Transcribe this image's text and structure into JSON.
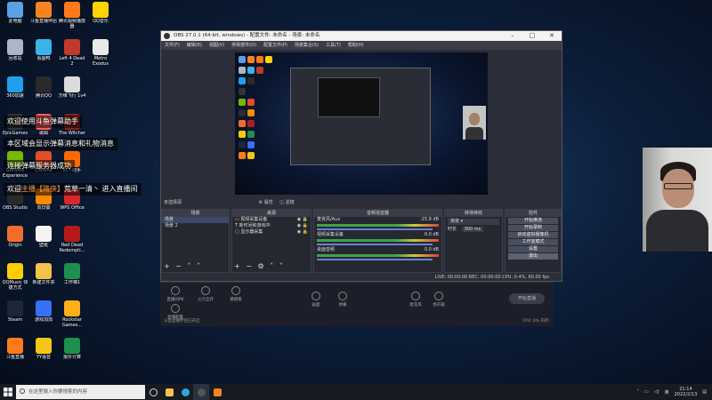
{
  "desktop": {
    "icons": [
      {
        "label": "此电脑",
        "color": "#5aa0e6"
      },
      {
        "label": "斗鱼直播伴侣",
        "color": "#f7831e"
      },
      {
        "label": "腾讯视频播放器",
        "color": "#ff7a1a"
      },
      {
        "label": "QQ音乐",
        "color": "#ffd400"
      },
      {
        "label": "回收站",
        "color": "#aab7c6"
      },
      {
        "label": "看图鸭",
        "color": "#3bb3e8"
      },
      {
        "label": "Left 4 Dead 2",
        "color": "#c23a2a"
      },
      {
        "label": "Metro Exodus",
        "color": "#e9e9e9"
      },
      {
        "label": "360加速",
        "color": "#1fa0ec"
      },
      {
        "label": "腾讯QQ",
        "color": "#2a2a2a"
      },
      {
        "label": "万维飞行 1v4",
        "color": "#dcdcdc"
      },
      {
        "label": "EpicGames",
        "color": "#333333"
      },
      {
        "label": "歌曲",
        "color": "#ff5d5d"
      },
      {
        "label": "The Witcher",
        "color": "#8a1e1e"
      },
      {
        "label": "GeForce Experience",
        "color": "#76b900"
      },
      {
        "label": "Chrome",
        "color": "#e44d26"
      },
      {
        "label": "红人助手",
        "color": "#ff6a00"
      },
      {
        "label": "OBS Studio",
        "color": "#2b2b2b"
      },
      {
        "label": "向日葵",
        "color": "#ff8a00"
      },
      {
        "label": "WPS Office",
        "color": "#d7282f"
      },
      {
        "label": "Origin",
        "color": "#f56c2d"
      },
      {
        "label": "壁纸",
        "color": "#f4f4f4"
      },
      {
        "label": "Red Dead Redempti...",
        "color": "#b51a1a"
      },
      {
        "label": "QQMusic 快捷方式",
        "color": "#ffcd00"
      },
      {
        "label": "新建文件夹",
        "color": "#f3c24a"
      },
      {
        "label": "工作簿1",
        "color": "#1d8f4e"
      },
      {
        "label": "Steam",
        "color": "#1b2838"
      },
      {
        "label": "游戏加加",
        "color": "#3a6ff7"
      },
      {
        "label": "Rockstar Games...",
        "color": "#fcaf17"
      },
      {
        "label": "斗鱼直播",
        "color": "#ff7a18"
      },
      {
        "label": "YY语音",
        "color": "#f5c518"
      },
      {
        "label": "报价计算",
        "color": "#1d8f4e"
      }
    ],
    "overlay_lines": [
      {
        "pre": "欢迎使用斗鱼弹幕助手",
        "hl": "",
        "post": ""
      },
      {
        "pre": "本区域会显示弹幕消息和礼物消息",
        "hl": "",
        "post": ""
      },
      {
        "pre": "连接弹幕服务器成功",
        "hl": "",
        "post": ""
      },
      {
        "pre": "欢迎",
        "hl": "主播【路侠】",
        "post": "荒草一清丶 进入直播间"
      }
    ]
  },
  "obs": {
    "title": "OBS 27.0.1 (64-bit, windows) - 配置文件: 未命名 - 场景: 未命名",
    "menu": [
      "文件(F)",
      "编辑(E)",
      "视图(V)",
      "停靠部件(D)",
      "配置文件(P)",
      "场景集合(S)",
      "工具(T)",
      "帮助(H)"
    ],
    "status_bar_label": "未选择源",
    "properties_btn": "属性",
    "filters_btn": "滤镜",
    "scenes": {
      "header": "场景",
      "items": [
        "场景",
        "场景 2"
      ]
    },
    "sources": {
      "header": "来源",
      "items": [
        "视频采集设备",
        "新时间和游戏中",
        "显示器采集"
      ]
    },
    "mixer": {
      "header": "音频混音器",
      "tracks": [
        {
          "name": "麦克风/Aux",
          "db": "-15.9 dB"
        },
        {
          "name": "视频采集设备",
          "db": "0.0 dB"
        },
        {
          "name": "桌面音频",
          "db": "0.0 dB"
        }
      ]
    },
    "transitions": {
      "header": "转场特效",
      "type": "渐变",
      "duration_label": "时长",
      "duration": "300 ms"
    },
    "controls": {
      "header": "控件",
      "buttons": [
        "开始推流",
        "开始录制",
        "启动虚拟摄像机",
        "工作室模式",
        "设置",
        "退出"
      ]
    },
    "status": "LIVE: 00:00:00   REC: 00:00:00   CPU: 0.4%, 60.00 fps"
  },
  "helper": {
    "buttons": [
      "直播间PK",
      "火力全开",
      "摸摸看",
      "直播配置",
      "画面",
      "弹幕",
      "麦克风",
      "扬声器"
    ],
    "start": "开始直播",
    "note": "斗鱼直播伴侣已开启",
    "status": "CPU: 0%  内存:"
  },
  "taskbar": {
    "search_placeholder": "在这里输入你要搜索的内容",
    "time": "21:14",
    "date": "2022/2/13",
    "lang": "英"
  }
}
